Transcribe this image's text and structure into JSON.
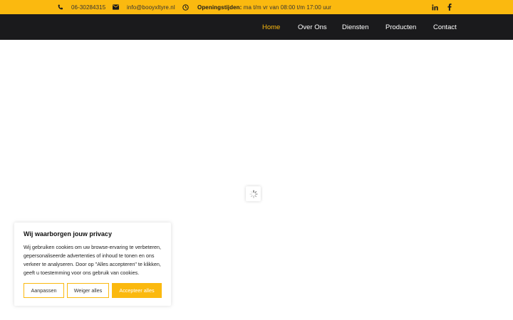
{
  "topbar": {
    "phone": "06-30284315",
    "email": "info@booyxltyre.nl",
    "hours_label": "Openingstijden:",
    "hours_value": "ma t/m vr van 08:00 t/m 17:00 uur",
    "icons": [
      "phone-icon",
      "envelope-icon",
      "clock-icon",
      "linkedin-icon",
      "facebook-icon"
    ]
  },
  "nav": {
    "items": [
      {
        "label": "Home",
        "active": true
      },
      {
        "label": "Over Ons",
        "active": false
      },
      {
        "label": "Diensten",
        "active": false
      },
      {
        "label": "Producten",
        "active": false
      },
      {
        "label": "Contact",
        "active": false
      }
    ]
  },
  "cookie": {
    "title": "Wij waarborgen jouw privacy",
    "text": "Wij gebruiken cookies om uw browse-ervaring te verbeteren, gepersonaliseerde advertenties of inhoud te tonen en ons verkeer te analyseren. Door op \"Alles accepteren\" te klikken, geeft u toestemming voor ons gebruik van cookies.",
    "buttons": {
      "customize": "Aanpassen",
      "reject": "Weiger alles",
      "accept": "Accepteer alles"
    }
  },
  "colors": {
    "accent": "#fbb90f",
    "nav_bg": "#1a1a1c",
    "text_dark": "#1b1b1b"
  }
}
